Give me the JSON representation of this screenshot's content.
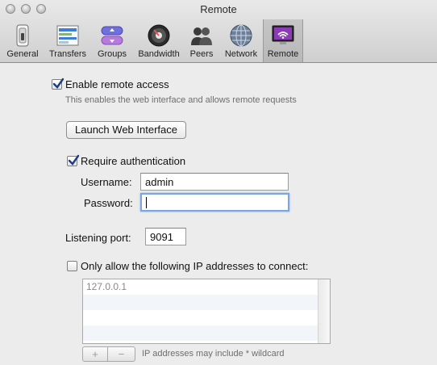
{
  "window": {
    "title": "Remote"
  },
  "toolbar": {
    "items": [
      {
        "label": "General",
        "icon": "switch-icon"
      },
      {
        "label": "Transfers",
        "icon": "transfers-list-icon"
      },
      {
        "label": "Groups",
        "icon": "groups-icon"
      },
      {
        "label": "Bandwidth",
        "icon": "speedometer-icon"
      },
      {
        "label": "Peers",
        "icon": "peers-icon"
      },
      {
        "label": "Network",
        "icon": "globe-icon"
      },
      {
        "label": "Remote",
        "icon": "monitor-remote-icon"
      }
    ],
    "selected": "Remote"
  },
  "remote": {
    "enable": {
      "label": "Enable remote access",
      "checked": true
    },
    "enable_hint": "This enables the web interface and allows remote requests",
    "launch_button": "Launch Web Interface",
    "auth": {
      "label": "Require authentication",
      "checked": true
    },
    "username": {
      "label": "Username:",
      "value": "admin"
    },
    "password": {
      "label": "Password:",
      "value": ""
    },
    "port": {
      "label": "Listening port:",
      "value": "9091"
    },
    "ip_filter": {
      "label": "Only allow the following IP addresses to connect:",
      "checked": false
    },
    "ip_list": [
      "127.0.0.1",
      "",
      "",
      ""
    ],
    "add_label": "+",
    "remove_label": "−",
    "ip_hint": "IP addresses may include * wildcard"
  },
  "colors": {
    "accent": "#2c6fd3",
    "focus_ring": "#7ba6e0",
    "remote_icon": "#8a3bb5"
  }
}
